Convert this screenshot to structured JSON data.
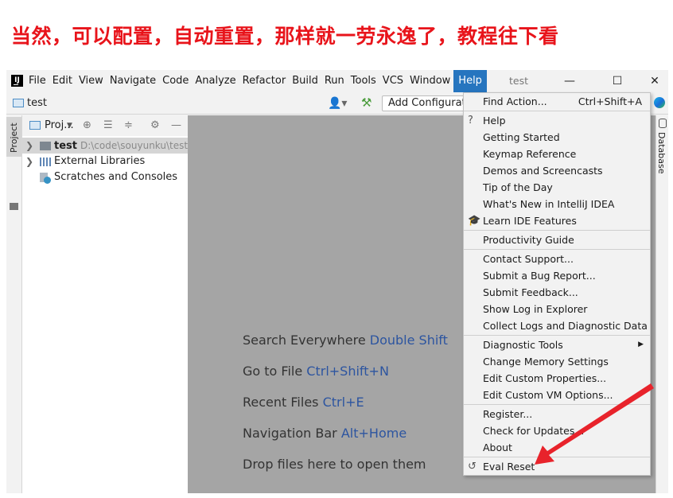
{
  "caption": "当然，可以配置，自动重置，那样就一劳永逸了，教程往下看",
  "app": {
    "logo_text": "IJ",
    "window_title": "test"
  },
  "menubar": {
    "items": [
      "File",
      "Edit",
      "View",
      "Navigate",
      "Code",
      "Analyze",
      "Refactor",
      "Build",
      "Run",
      "Tools",
      "VCS",
      "Window",
      "Help"
    ],
    "active_index": 12,
    "window_controls": {
      "minimize": "—",
      "maximize": "☐",
      "close": "✕"
    }
  },
  "navbar": {
    "project_name": "test",
    "run_config_placeholder": "Add Configuration..."
  },
  "left_strip": {
    "project_tab": "Project"
  },
  "right_strip": {
    "database_tab": "Database"
  },
  "project_panel": {
    "header_label": "Proj...",
    "tree": [
      {
        "label": "test",
        "path": "D:\\code\\souyunku\\test",
        "bold": true,
        "selected": true,
        "expandable": true,
        "icon": "folder-icon"
      },
      {
        "label": "External Libraries",
        "path": "",
        "bold": false,
        "selected": false,
        "expandable": true,
        "icon": "library-icon"
      },
      {
        "label": "Scratches and Consoles",
        "path": "",
        "bold": false,
        "selected": false,
        "expandable": false,
        "icon": "scratches-icon"
      }
    ]
  },
  "editor_hints": [
    {
      "text": "Search Everywhere",
      "key": "Double Shift"
    },
    {
      "text": "Go to File",
      "key": "Ctrl+Shift+N"
    },
    {
      "text": "Recent Files",
      "key": "Ctrl+E"
    },
    {
      "text": "Navigation Bar",
      "key": "Alt+Home"
    },
    {
      "text": "Drop files here to open them",
      "key": ""
    }
  ],
  "help_menu": {
    "groups": [
      [
        {
          "label": "Find Action...",
          "shortcut": "Ctrl+Shift+A"
        }
      ],
      [
        {
          "label": "Help",
          "icon": "?"
        },
        {
          "label": "Getting Started"
        },
        {
          "label": "Keymap Reference"
        },
        {
          "label": "Demos and Screencasts"
        },
        {
          "label": "Tip of the Day"
        },
        {
          "label": "What's New in IntelliJ IDEA"
        },
        {
          "label": "Learn IDE Features",
          "icon": "🎓"
        }
      ],
      [
        {
          "label": "Productivity Guide"
        }
      ],
      [
        {
          "label": "Contact Support..."
        },
        {
          "label": "Submit a Bug Report..."
        },
        {
          "label": "Submit Feedback..."
        },
        {
          "label": "Show Log in Explorer"
        },
        {
          "label": "Collect Logs and Diagnostic Data"
        }
      ],
      [
        {
          "label": "Diagnostic Tools",
          "submenu": true
        },
        {
          "label": "Change Memory Settings"
        },
        {
          "label": "Edit Custom Properties..."
        },
        {
          "label": "Edit Custom VM Options..."
        }
      ],
      [
        {
          "label": "Register..."
        },
        {
          "label": "Check for Updates..."
        },
        {
          "label": "About"
        }
      ],
      [
        {
          "label": "Eval Reset",
          "icon": "↺"
        }
      ]
    ]
  },
  "colors": {
    "caption": "#e8141b",
    "menu_active": "#2675bf",
    "shortcut_key": "#2d55a0",
    "annotation_arrow": "#e8232b"
  }
}
